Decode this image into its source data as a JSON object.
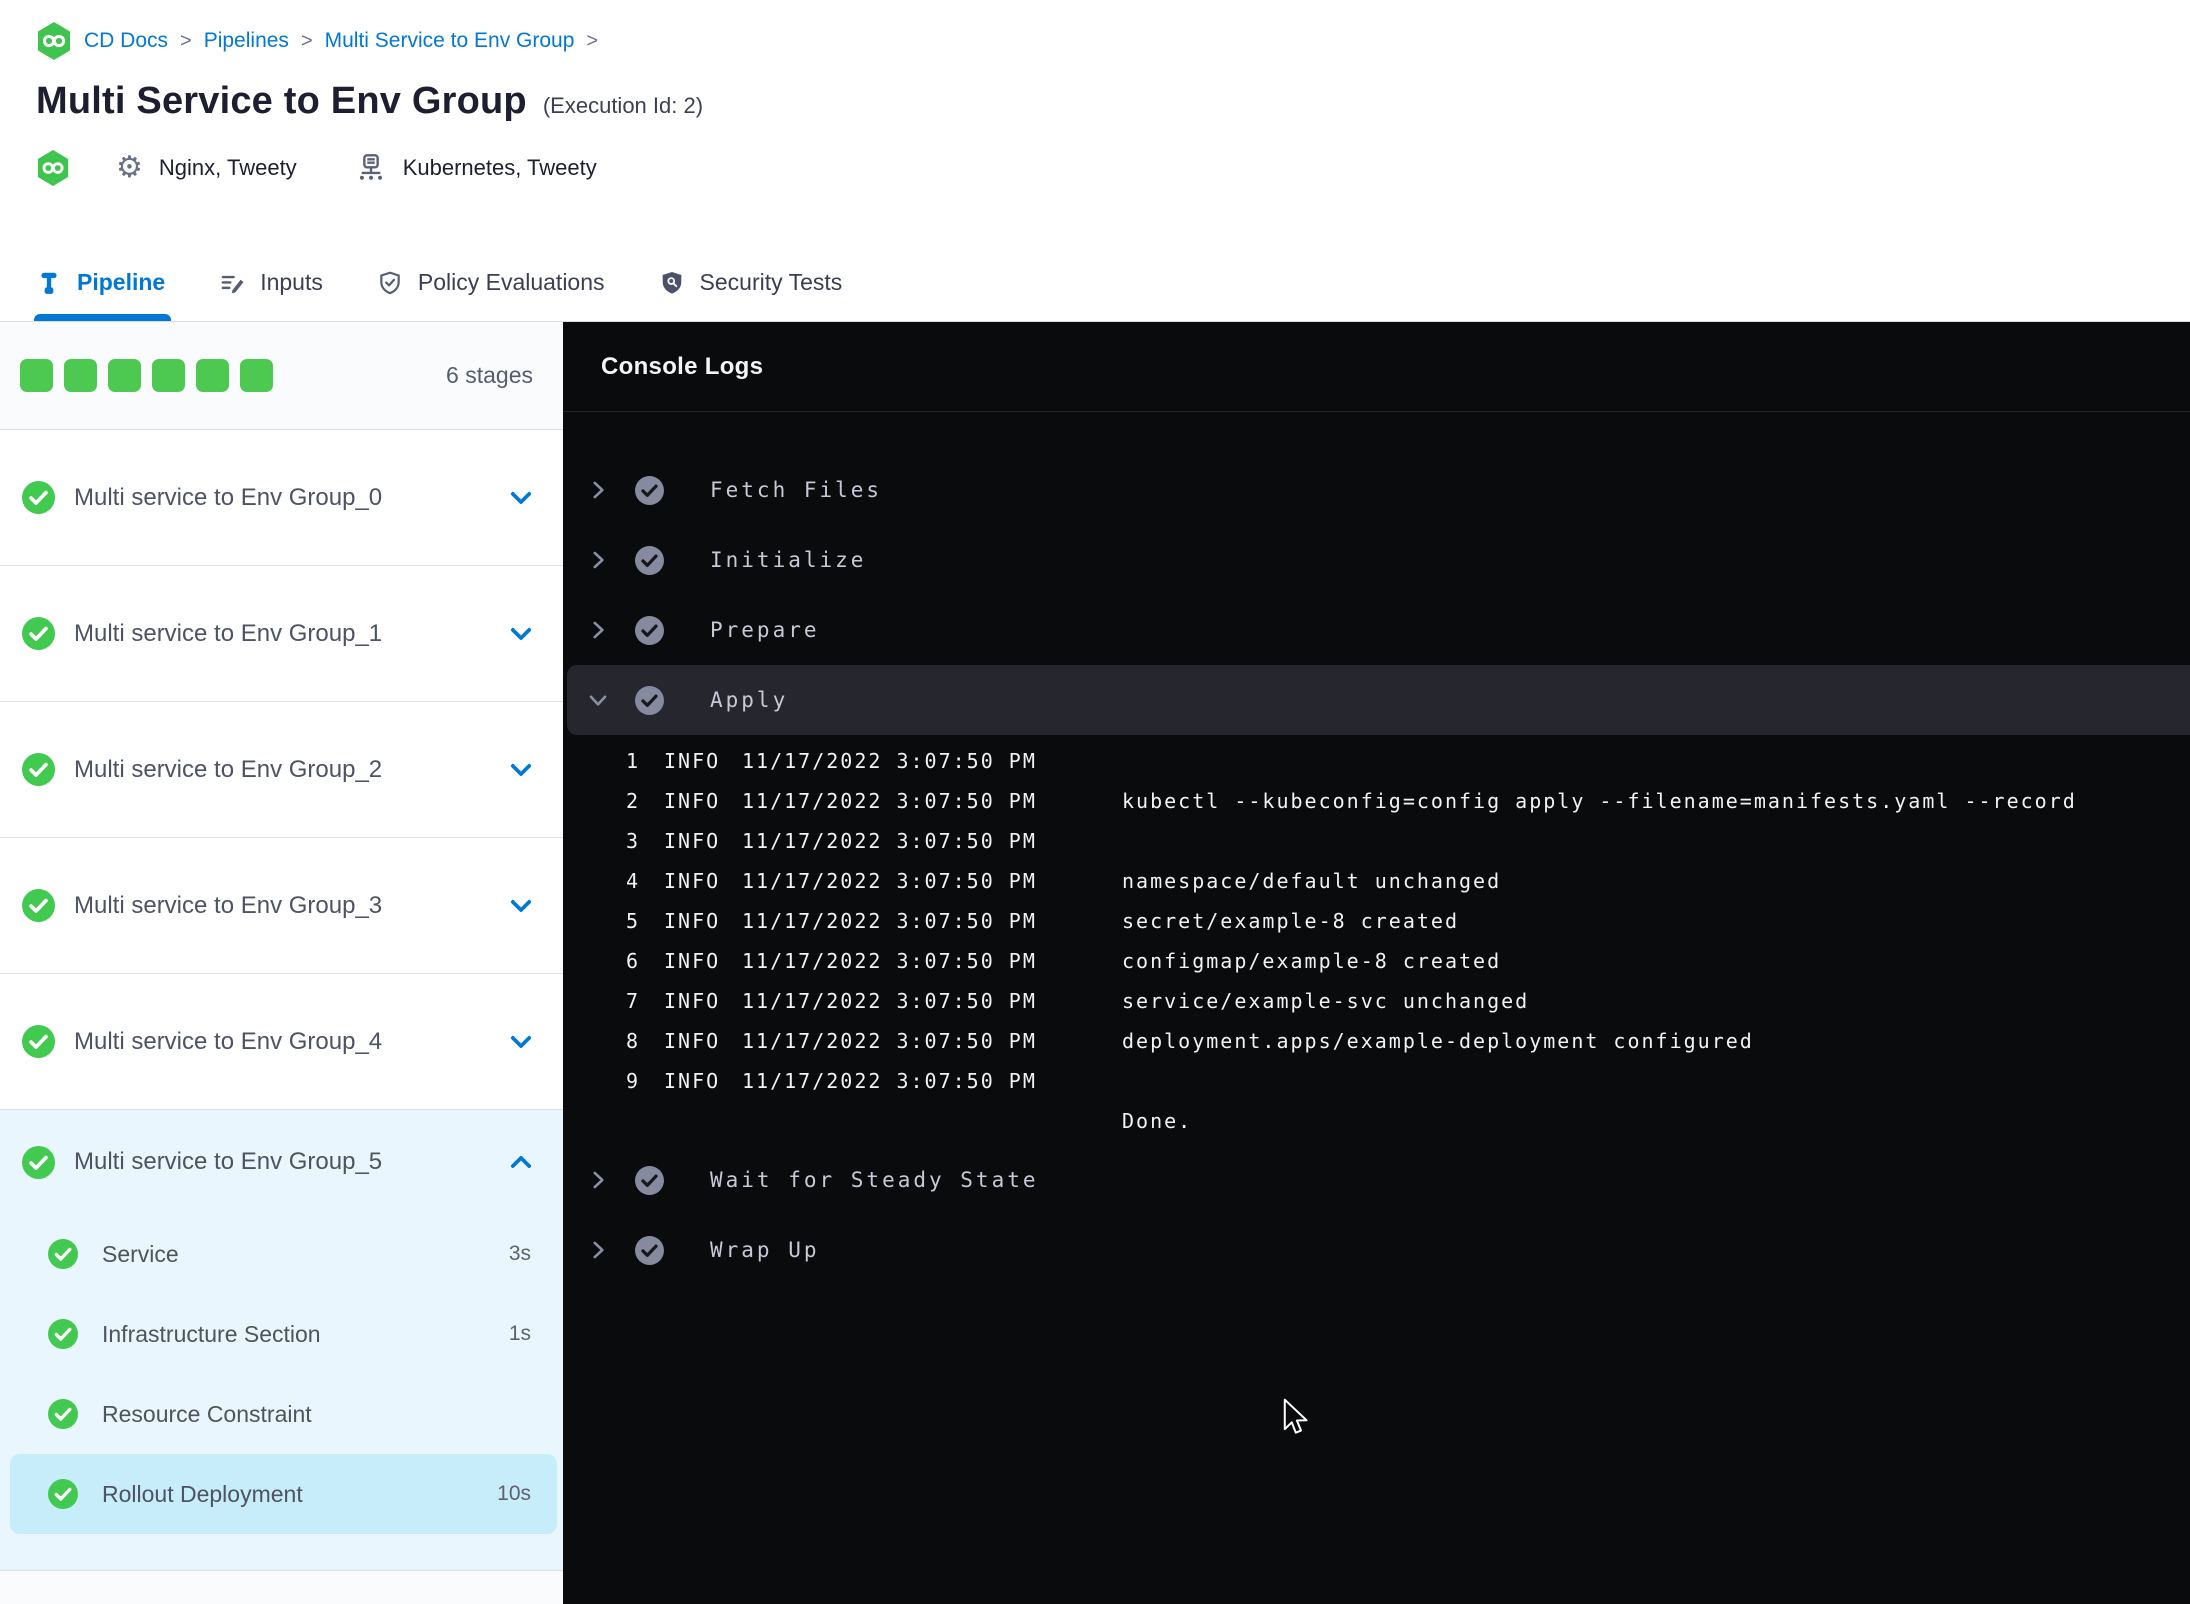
{
  "breadcrumb": {
    "items": [
      "CD Docs",
      "Pipelines",
      "Multi Service to Env Group"
    ],
    "separator": ">"
  },
  "header": {
    "title": "Multi Service to Env Group",
    "execution_id": "(Execution Id: 2)",
    "services": "Nginx, Tweety",
    "environments": "Kubernetes, Tweety"
  },
  "tabs": [
    {
      "label": "Pipeline",
      "active": true
    },
    {
      "label": "Inputs"
    },
    {
      "label": "Policy Evaluations"
    },
    {
      "label": "Security Tests"
    }
  ],
  "sidebar": {
    "stage_count_label": "6 stages",
    "progress_squares": [
      {
        "status": "success"
      },
      {
        "status": "success"
      },
      {
        "status": "success"
      },
      {
        "status": "success"
      },
      {
        "status": "success"
      },
      {
        "status": "success"
      }
    ],
    "stages": [
      {
        "label": "Multi service to Env Group_0"
      },
      {
        "label": "Multi service to Env Group_1"
      },
      {
        "label": "Multi service to Env Group_2"
      },
      {
        "label": "Multi service to Env Group_3"
      },
      {
        "label": "Multi service to Env Group_4"
      }
    ],
    "expanded_stage": {
      "label": "Multi service to Env Group_5",
      "steps": [
        {
          "label": "Service",
          "duration": "3s"
        },
        {
          "label": "Infrastructure Section",
          "duration": "1s"
        },
        {
          "label": "Resource Constraint",
          "duration": ""
        },
        {
          "label": "Rollout Deployment",
          "duration": "10s",
          "selected": true
        }
      ]
    }
  },
  "console": {
    "title": "Console Logs",
    "steps_before": [
      {
        "label": "Fetch Files"
      },
      {
        "label": "Initialize"
      },
      {
        "label": "Prepare"
      }
    ],
    "active_step": {
      "label": "Apply"
    },
    "log_lines": [
      {
        "num": "1",
        "level": "INFO",
        "time": "11/17/2022 3:07:50 PM",
        "msg": ""
      },
      {
        "num": "2",
        "level": "INFO",
        "time": "11/17/2022 3:07:50 PM",
        "msg": "kubectl --kubeconfig=config apply --filename=manifests.yaml --record"
      },
      {
        "num": "3",
        "level": "INFO",
        "time": "11/17/2022 3:07:50 PM",
        "msg": ""
      },
      {
        "num": "4",
        "level": "INFO",
        "time": "11/17/2022 3:07:50 PM",
        "msg": "namespace/default unchanged"
      },
      {
        "num": "5",
        "level": "INFO",
        "time": "11/17/2022 3:07:50 PM",
        "msg": "secret/example-8 created"
      },
      {
        "num": "6",
        "level": "INFO",
        "time": "11/17/2022 3:07:50 PM",
        "msg": "configmap/example-8 created"
      },
      {
        "num": "7",
        "level": "INFO",
        "time": "11/17/2022 3:07:50 PM",
        "msg": "service/example-svc unchanged"
      },
      {
        "num": "8",
        "level": "INFO",
        "time": "11/17/2022 3:07:50 PM",
        "msg": "deployment.apps/example-deployment configured"
      },
      {
        "num": "9",
        "level": "INFO",
        "time": "11/17/2022 3:07:50 PM",
        "msg": ""
      },
      {
        "num": "",
        "level": "",
        "time": "",
        "msg": "Done."
      }
    ],
    "steps_after": [
      {
        "label": "Wait for Steady State"
      },
      {
        "label": "Wrap Up"
      }
    ]
  },
  "colors": {
    "accent_blue": "#0278d5",
    "success_green": "#42c94f",
    "square_green": "#4dc952",
    "console_bg": "#0a0b0d",
    "active_log_row_bg": "#26272e",
    "selected_step_bg": "#c7ecfa",
    "expanded_stage_bg": "#e9f6fd"
  }
}
